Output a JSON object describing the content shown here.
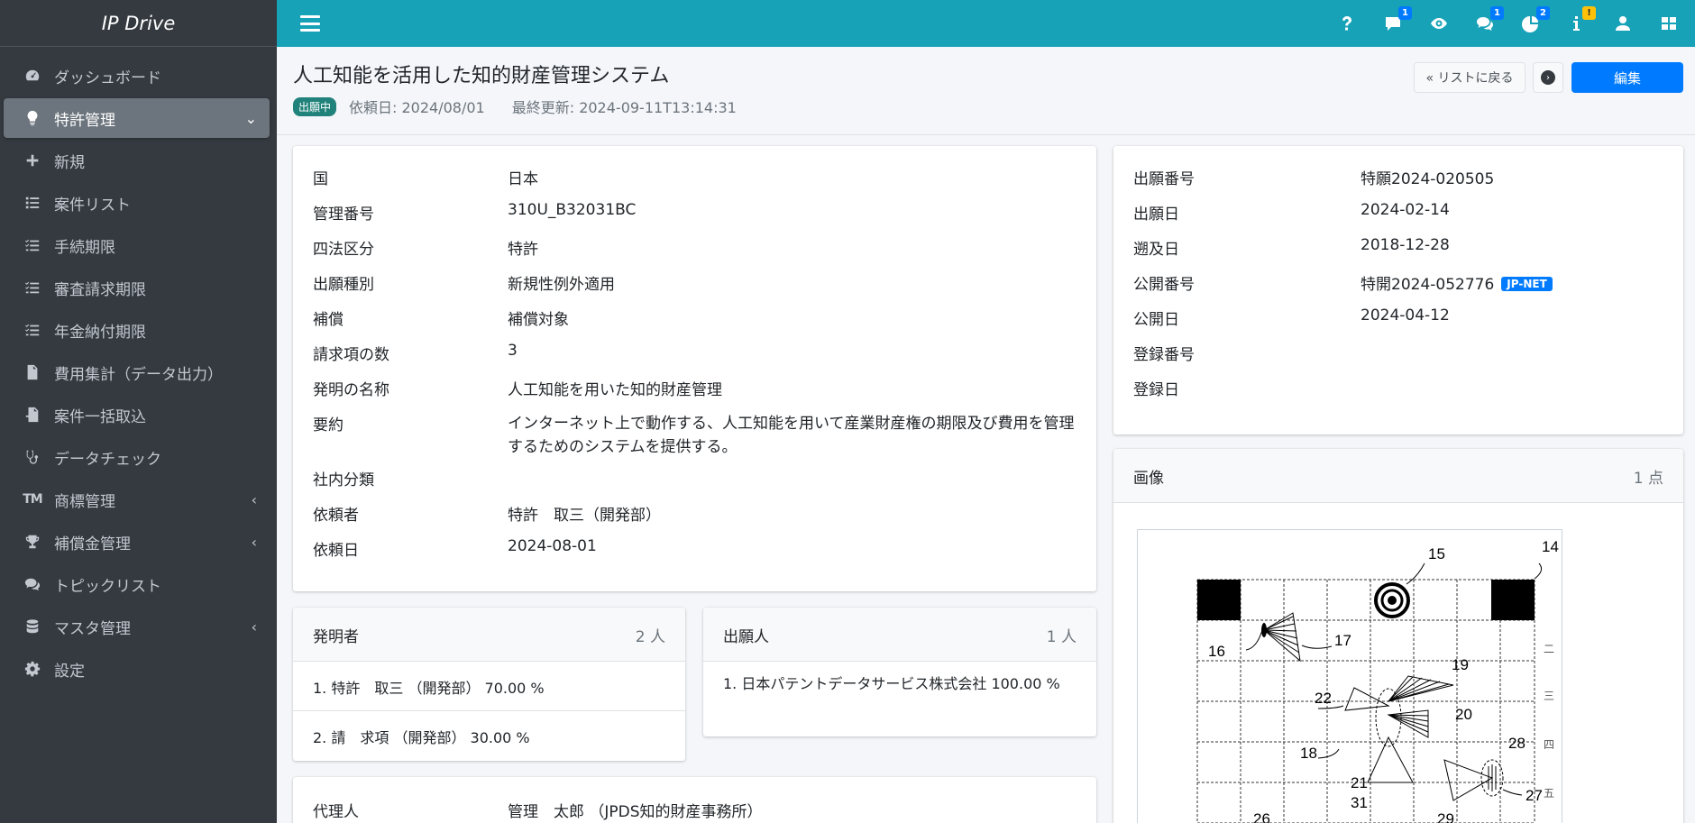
{
  "app": {
    "brand": "IP Drive"
  },
  "sidebar": {
    "items": [
      {
        "label": "ダッシュボード",
        "icon": "dashboard-icon"
      },
      {
        "label": "特許管理",
        "icon": "lightbulb-icon",
        "active": true,
        "caret": "down"
      },
      {
        "label": "新規",
        "icon": "plus-icon"
      },
      {
        "label": "案件リスト",
        "icon": "list-icon"
      },
      {
        "label": "手続期限",
        "icon": "checklist-icon"
      },
      {
        "label": "審査請求期限",
        "icon": "checklist-icon"
      },
      {
        "label": "年金納付期限",
        "icon": "checklist-icon"
      },
      {
        "label": "費用集計（データ出力）",
        "icon": "file-export-icon"
      },
      {
        "label": "案件一括取込",
        "icon": "file-import-icon"
      },
      {
        "label": "データチェック",
        "icon": "stethoscope-icon"
      },
      {
        "label": "商標管理",
        "icon": "trademark-icon",
        "tm": "TM",
        "caret": "left"
      },
      {
        "label": "補償金管理",
        "icon": "trophy-icon",
        "caret": "left"
      },
      {
        "label": "トピックリスト",
        "icon": "comments-icon"
      },
      {
        "label": "マスタ管理",
        "icon": "database-icon",
        "caret": "left"
      },
      {
        "label": "設定",
        "icon": "gear-icon"
      }
    ]
  },
  "topbar": {
    "badges": {
      "comment": "1",
      "comments": "1",
      "chart": "2",
      "info": "!"
    }
  },
  "header": {
    "title": "人工知能を活用した知的財産管理システム",
    "status": "出願中",
    "request_date": "依頼日: 2024/08/01",
    "last_updated": "最終更新: 2024-09-11T13:14:31",
    "back_label": "« リストに戻る",
    "edit_label": "編集"
  },
  "details": {
    "rows": [
      {
        "label": "国",
        "value": "日本"
      },
      {
        "label": "管理番号",
        "value": "310U_B32031BC"
      },
      {
        "label": "四法区分",
        "value": "特許"
      },
      {
        "label": "出願種別",
        "value": "新規性例外適用"
      },
      {
        "label": "補償",
        "value": "補償対象"
      },
      {
        "label": "請求項の数",
        "value": "3"
      },
      {
        "label": "発明の名称",
        "value": "人工知能を用いた知的財産管理"
      },
      {
        "label": "要約",
        "value": "インターネット上で動作する、人工知能を用いて産業財産権の期限及び費用を管理するためのシステムを提供する。"
      },
      {
        "label": "社内分類",
        "value": ""
      },
      {
        "label": "依頼者",
        "value": "特許　取三（開発部）"
      },
      {
        "label": "依頼日",
        "value": "2024-08-01"
      }
    ]
  },
  "application": {
    "rows": [
      {
        "label": "出願番号",
        "value": "特願2024-020505"
      },
      {
        "label": "出願日",
        "value": "2024-02-14"
      },
      {
        "label": "遡及日",
        "value": "2018-12-28"
      },
      {
        "label": "公開番号",
        "value": "特開2024-052776",
        "badge": "JP-NET"
      },
      {
        "label": "公開日",
        "value": "2024-04-12"
      },
      {
        "label": "登録番号",
        "value": ""
      },
      {
        "label": "登録日",
        "value": ""
      }
    ]
  },
  "inventors": {
    "title": "発明者",
    "count": "2 人",
    "items": [
      "1. 特許　取三 （開発部） 70.00 %",
      "2. 請　求項 （開発部） 30.00 %"
    ]
  },
  "applicants": {
    "title": "出願人",
    "count": "1 人",
    "items": [
      "1. 日本パテントデータサービス株式会社 100.00 %"
    ]
  },
  "agent": {
    "label": "代理人",
    "value": "管理　太郎 （JPDS知的財産事務所）"
  },
  "images": {
    "title": "画像",
    "count": "1 点",
    "figure_labels": [
      "15",
      "14",
      "16",
      "17",
      "19",
      "22",
      "20",
      "28",
      "18",
      "21",
      "27",
      "31",
      "26",
      "29"
    ],
    "figure_side_marks": [
      "二",
      "三",
      "四",
      "五"
    ]
  }
}
